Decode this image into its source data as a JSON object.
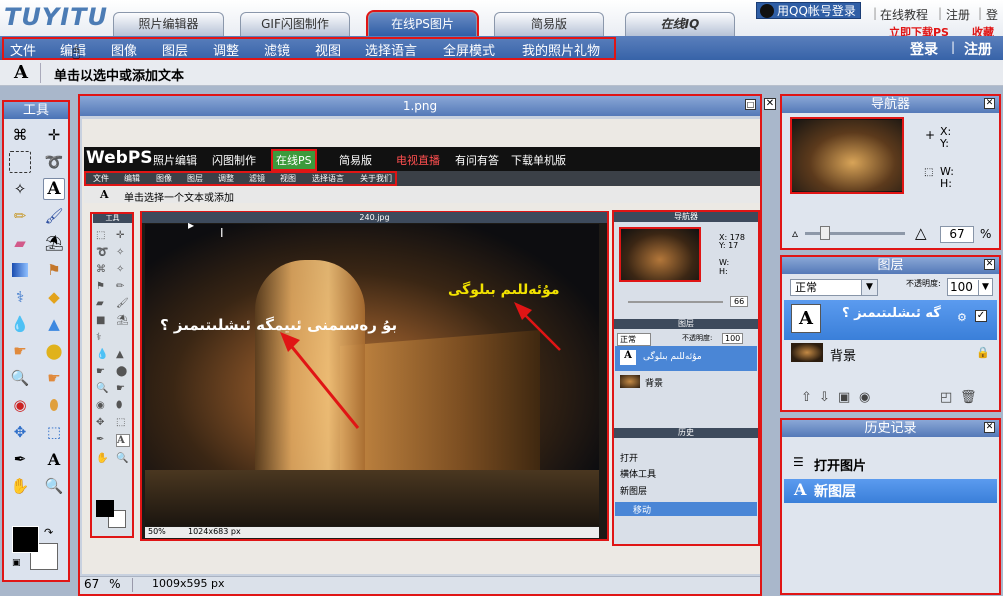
{
  "app": {
    "logo": "TUYITU"
  },
  "tabs": [
    {
      "label": "照片编辑器"
    },
    {
      "label": "GIF闪图制作"
    },
    {
      "label": "在线PS图片"
    },
    {
      "label": "简易版"
    },
    {
      "label": "在线IQ"
    }
  ],
  "top_links": {
    "qq_login": "用QQ帐号登录",
    "tutorial": "在线教程",
    "register": "注册",
    "login": "登",
    "download": "立即下载PS",
    "favorite": "收藏本"
  },
  "menu": [
    "文件",
    "编辑",
    "图像",
    "图层",
    "调整",
    "滤镜",
    "视图",
    "选择语言",
    "全屏模式",
    "我的照片礼物"
  ],
  "account": {
    "login": "登录",
    "separator": "|",
    "register": "注册"
  },
  "options_bar": {
    "icon": "text-tool-icon",
    "hint": "单击以选中或添加文本"
  },
  "tool_panel": {
    "title": "工具"
  },
  "document": {
    "title": "1.png",
    "zoom": "67",
    "zoom_unit": "%",
    "size": "1009x595 px"
  },
  "inner_screenshot": {
    "logo": "WebPS",
    "tabs": [
      "照片编辑",
      "闪图制作",
      "在线PS",
      "简易版",
      "电视直播",
      "有问有答",
      "下载单机版"
    ],
    "menu": [
      "文件",
      "编辑",
      "图像",
      "图层",
      "调整",
      "滤镜",
      "视图",
      "选择语言",
      "关于我们"
    ],
    "hint": "单击选择一个文本或添加",
    "tools_title": "工具",
    "photo_title": "240.jpg",
    "photo_zoom": "50%",
    "photo_size": "1024x683 px",
    "overlay_text_1": "بۇ رەسىمنى ئىيمگە ئىشلىتىمىز ؟",
    "overlay_text_2": "مۇئەللىم بىلوگى",
    "nav_title": "导航器",
    "nav_x": "X: 178",
    "nav_y": "Y: 17",
    "nav_w": "W:",
    "nav_h": "H:",
    "nav_zoom": "66",
    "layers_title": "图层",
    "blend": "正常",
    "opacity_label": "不透明度:",
    "opacity": "100",
    "layer1": "مۇئەللىم بىلوگى",
    "layer2": "背景",
    "history_title": "历史",
    "history": [
      "打开",
      "横体工具",
      "新图层",
      "移动"
    ]
  },
  "navigator": {
    "title": "导航器",
    "x_label": "X:",
    "y_label": "Y:",
    "w_label": "W:",
    "h_label": "H:",
    "zoom": "67",
    "zoom_unit": "%"
  },
  "layers": {
    "title": "图层",
    "blend_mode": "正常",
    "opacity_label": "不透明度:",
    "opacity": "100",
    "layer1_name": "گە ئىشلىتىمىز ؟",
    "layer2_name": "背景"
  },
  "history": {
    "title": "历史记录",
    "items": [
      "打开图片",
      "新图层"
    ]
  },
  "colors": {
    "accent": "#3763a8",
    "highlight": "#e01515",
    "selection": "#3a7fd9"
  }
}
